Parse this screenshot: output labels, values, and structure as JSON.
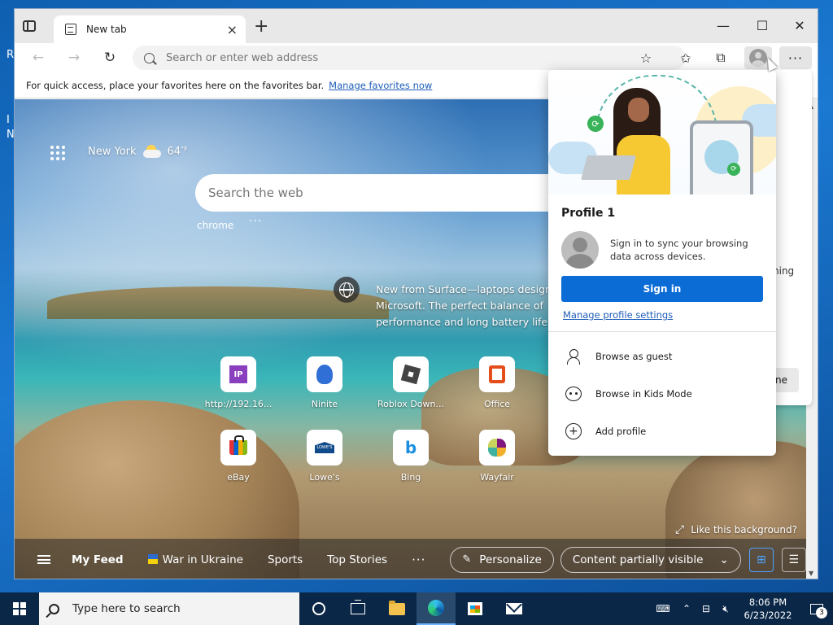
{
  "desktop": {
    "letters": [
      "R",
      "I",
      "N"
    ]
  },
  "tab": {
    "title": "New tab"
  },
  "window_controls": {
    "minimize": "—",
    "maximize": "☐",
    "close": "✕"
  },
  "toolbar": {
    "address_placeholder": "Search or enter web address"
  },
  "favorites_bar": {
    "message": "For quick access, place your favorites here on the favorites bar.",
    "link": "Manage favorites now"
  },
  "newtab": {
    "location": "New York",
    "temperature": "64",
    "temp_unit": "°F",
    "search_placeholder": "Search the web",
    "search_hint": "chrome",
    "promo_lines": [
      "New from Surface—laptops design",
      "Microsoft. The perfect balance of",
      "performance and long battery life"
    ],
    "tiles": [
      {
        "label": "http://192.16..."
      },
      {
        "label": "Ninite"
      },
      {
        "label": "Roblox Down..."
      },
      {
        "label": "Office"
      },
      {
        "label": "eBay"
      },
      {
        "label": "Lowe's"
      },
      {
        "label": "Bing"
      },
      {
        "label": "Wayfair"
      }
    ],
    "ip_logo_text": "IP",
    "lowes_logo_text": "LOWE'S",
    "bing_logo_text": "b",
    "background_prompt": "Like this background?"
  },
  "feed_bar": {
    "my_feed": "My Feed",
    "war": "War in Ukraine",
    "sports": "Sports",
    "top_stories": "Top Stories",
    "personalize": "Personalize",
    "content_visibility": "Content partially visible"
  },
  "side_panel": {
    "partial_text": "ning",
    "partial_button": "ne"
  },
  "profile_popup": {
    "title": "Profile 1",
    "description": "Sign in to sync your browsing data across devices.",
    "sign_in": "Sign in",
    "manage_link": "Manage profile settings",
    "items": [
      {
        "label": "Browse as guest"
      },
      {
        "label": "Browse in Kids Mode"
      },
      {
        "label": "Add profile"
      }
    ]
  },
  "taskbar": {
    "search_placeholder": "Type here to search",
    "time": "8:06 PM",
    "date": "6/23/2022",
    "notification_count": "3"
  }
}
